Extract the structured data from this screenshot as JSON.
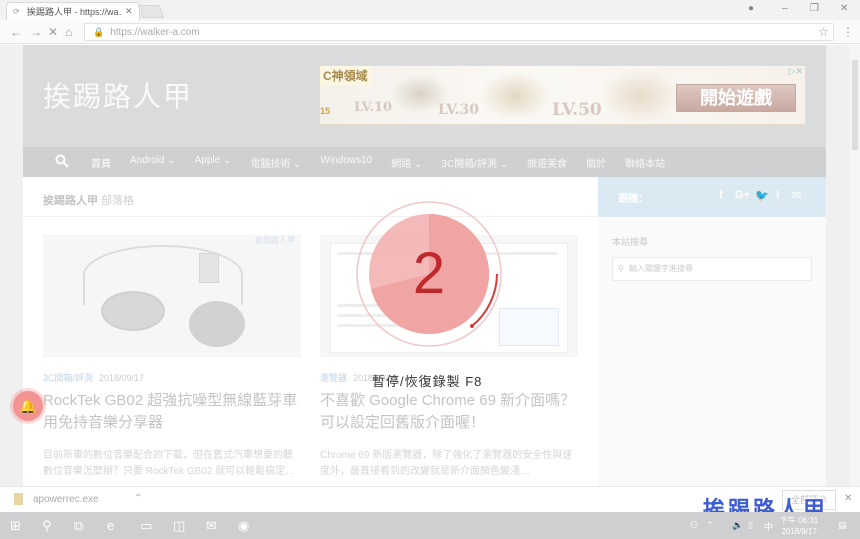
{
  "browser": {
    "tab_title": "挨踢路人甲 - https://wa…",
    "url": "https://walker-a.com"
  },
  "site": {
    "title": "挨踢路人甲",
    "banner": {
      "logo": "C神領域",
      "lv1": "LV.10",
      "lv2": "LV.30",
      "lv3": "LV.50",
      "cta": "開始遊戲",
      "rating": "15"
    },
    "nav": [
      "首頁",
      "Android ⌄",
      "Apple ⌄",
      "電腦技術 ⌄",
      "Windows10",
      "網路 ⌄",
      "3C開箱/評測 ⌄",
      "旅遊美食",
      "關於",
      "聯絡本站"
    ],
    "breadcrumb_main": "挨踢路人甲",
    "breadcrumb_sub": "部落格",
    "sidebar": {
      "follow_label": "跟隨：",
      "social": [
        "f",
        "G+",
        "🐦",
        "⌇",
        "✉"
      ],
      "search_title": "本站搜尋",
      "search_placeholder": "輸入關鍵字進搜尋"
    },
    "cards": [
      {
        "tag": "挨踢路人甲",
        "category": "3C開箱/評測",
        "date": "2018/09/17",
        "title": "RockTek GB02 超強抗噪型無線藍芽車用免持音樂分享器",
        "excerpt": "目前新車的數位音樂配合的下載，但在舊式汽車想要的聽數位音樂怎麼辦？只要 RockTek GB02 就可以輕鬆搞定…"
      },
      {
        "tag": "",
        "category": "瀏覽器",
        "date": "2018/09/17",
        "title": "不喜歡 Google Chrome 69 新介面嗎？可以設定回舊版介面喔！",
        "excerpt": "Chrome 69 新版瀏覽器，除了強化了瀏覽器的安全性與速度外，最直接看到的改變就是新介面顏色變淺…"
      }
    ]
  },
  "recording": {
    "countdown": "2",
    "hint": "暫停/恢復錄製  F8"
  },
  "download": {
    "filename": "apowerrec.exe",
    "show_all": "全部顯示"
  },
  "watermark": "挨踢路人甲",
  "taskbar": {
    "time": "下午 06:31",
    "date": "2018/9/17",
    "ime": "中"
  }
}
